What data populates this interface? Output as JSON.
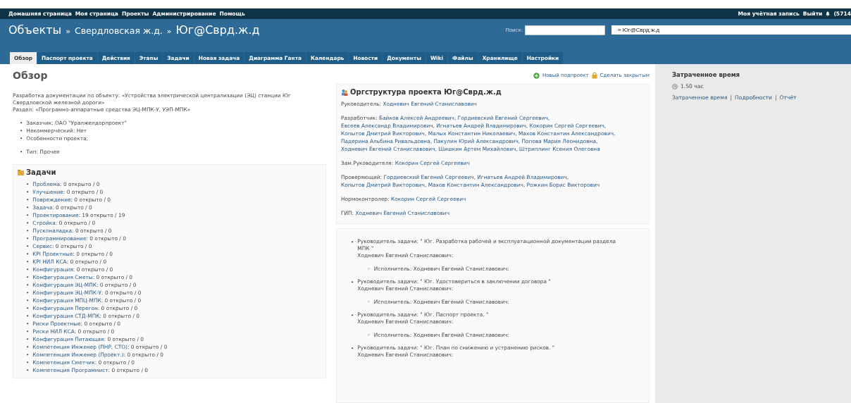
{
  "top_menu": [
    {
      "label": "Домашняя страница"
    },
    {
      "label": "Моя страница"
    },
    {
      "label": "Проекты"
    },
    {
      "label": "Администрирование"
    },
    {
      "label": "Помощь"
    }
  ],
  "account_menu": [
    {
      "label": "Моя учётная запись"
    },
    {
      "label": "Выйти"
    }
  ],
  "notifications": {
    "count": "(5714"
  },
  "breadcrumb": [
    {
      "text": "Объекты",
      "kind": "major"
    },
    {
      "text": "»",
      "kind": "separator"
    },
    {
      "text": "Свердловская ж.д.",
      "kind": "minor"
    },
    {
      "text": "»",
      "kind": "separator"
    },
    {
      "text": "Юг@Сврд.ж.д",
      "kind": "major"
    }
  ],
  "search": {
    "label": "Поиск:"
  },
  "project_select": {
    "value": "» Юг@Сврд.ж.д"
  },
  "tabs": [
    {
      "label": "Обзор",
      "selected": true
    },
    {
      "label": "Паспорт проекта",
      "selected": false
    },
    {
      "label": "Действия",
      "selected": false
    },
    {
      "label": "Этапы",
      "selected": false
    },
    {
      "label": "Задачи",
      "selected": false
    },
    {
      "label": "Новая задача",
      "selected": false
    },
    {
      "label": "Диаграмма Ганта",
      "selected": false
    },
    {
      "label": "Календарь",
      "selected": false
    },
    {
      "label": "Новости",
      "selected": false
    },
    {
      "label": "Документы",
      "selected": false
    },
    {
      "label": "Wiki",
      "selected": false
    },
    {
      "label": "Файлы",
      "selected": false
    },
    {
      "label": "Хранилище",
      "selected": false
    },
    {
      "label": "Настройки",
      "selected": false
    }
  ],
  "page_title": "Обзор",
  "actions": [
    {
      "label": "Новый подпроект",
      "kind": "add"
    },
    {
      "label": "Сделать закрытым",
      "kind": "lock"
    }
  ],
  "description": [
    "Разработка документации по объекту: «Устройства электрической централизации (ЭЦ) станции Юг Свердловской железной дороги»",
    "Раздел: «Програмно-аппаратные средства ЭЦ-МПК-У, УЭП-МПК»"
  ],
  "bullets": {
    "main": "•",
    "sub": "◦"
  },
  "custom_fields": [
    [
      "Заказчик: ОАО \"Уралжелдорпроект\"",
      "Некоммерческий: Нет",
      "Особенности проекта:"
    ],
    [
      "Тип: Прочее"
    ]
  ],
  "issues": {
    "title": "Задачи",
    "items": [
      {
        "tracker": "Проблема",
        "stats": ": 0 открыто / 0"
      },
      {
        "tracker": "Улучшение",
        "stats": ": 0 открыто / 0"
      },
      {
        "tracker": "Повреждение",
        "stats": ": 0 открыто / 0"
      },
      {
        "tracker": "Задача",
        "stats": ": 0 открыто / 0"
      },
      {
        "tracker": "Проектирование",
        "stats": ": 19 открыто / 19"
      },
      {
        "tracker": "Стройка",
        "stats": ": 0 открыто / 0"
      },
      {
        "tracker": "Пусконаладка",
        "stats": ": 0 открыто / 0"
      },
      {
        "tracker": "Программирование",
        "stats": ": 0 открыто / 0"
      },
      {
        "tracker": "Сервис",
        "stats": ": 0 открыто / 0"
      },
      {
        "tracker": "KPI Проектные",
        "stats": ": 0 открыто / 0"
      },
      {
        "tracker": "KPI НИЛ КСА",
        "stats": ": 0 открыто / 0"
      },
      {
        "tracker": "Конфигурация",
        "stats": ": 0 открыто / 0"
      },
      {
        "tracker": "Конфигурация Сметы",
        "stats": ": 0 открыто / 0"
      },
      {
        "tracker": "Конфигурация ЭЦ-МПК",
        "stats": ": 0 открыто / 0"
      },
      {
        "tracker": "Конфигурация ЭЦ-МПК-У",
        "stats": ": 0 открыто / 0"
      },
      {
        "tracker": "Конфигурация МПЦ-МПК",
        "stats": ": 0 открыто / 0"
      },
      {
        "tracker": "Конфигурация Перегон",
        "stats": ": 0 открыто / 0"
      },
      {
        "tracker": "Конфигурация СТД-МПК",
        "stats": ": 0 открыто / 0"
      },
      {
        "tracker": "Риски Проектные",
        "stats": ": 0 открыто / 0"
      },
      {
        "tracker": "Риски НИЛ КСА",
        "stats": ": 0 открыто / 0"
      },
      {
        "tracker": "Конфигурация Питающая",
        "stats": ": 0 открыто / 0"
      },
      {
        "tracker": "Компетенция Инженер (ПНР, СТО)",
        "stats": ": 0 открыто / 0"
      },
      {
        "tracker": "Компетенция Инженер (Проект.)",
        "stats": ": 0 открыто / 0"
      },
      {
        "tracker": "Компетенция Сметчик",
        "stats": ": 0 открыто / 0"
      },
      {
        "tracker": "Компетенция Программист",
        "stats": ": 0 открыто / 0"
      }
    ]
  },
  "org_structure": {
    "title": "Оргструктура проекта Юг@Сврд.ж.д",
    "roles": [
      {
        "role": "Руководитель:",
        "people": [
          "Ходневич Евгений Станиславович"
        ]
      },
      {
        "role": "Разработчик:",
        "people": [
          "Байков Алексей Андреевич,",
          "Гордиевский Евгений Сергеевич,",
          "Евсеев Александр Владимирович,",
          "Игнатьев Андрей Владимирович,",
          "Кокорин Сергей Сергеевич,",
          "Копытов Дмитрий Викторович,",
          "Малых Константин Николаевич,",
          "Махов Константин Александрович,",
          "Падерина Альбина Ривальдовна,",
          "Пакулин Юрий Александрович,",
          "Попова Мария Леонидовна,",
          "Ходневич Евгений Станиславович,",
          "Шишкин Артем Михайлович,",
          "Штриплинг Ксения Олеговна"
        ]
      },
      {
        "role": "Зам.Руководителя:",
        "people": [
          "Кокорин Сергей Сергеевич"
        ]
      },
      {
        "role": "Проверяющий:",
        "people": [
          "Гордиевский Евгений Сергеевич,",
          "Игнатьев Андрей Владимирович,",
          "Копытов Дмитрий Викторович,",
          "Махов Константин Александрович,",
          "Рожкин Борис Викторович"
        ]
      },
      {
        "role": "Нормоконтролер:",
        "people": [
          "Кокорин Сергей Сергеевич"
        ]
      },
      {
        "role": "ГИП:",
        "people": [
          "Ходневич Евгений Станиславович"
        ]
      }
    ]
  },
  "task_tree": [
    {
      "leader": "Руководитель задачи: \" Юг. Разработка рабочей и эксплуатационной документации раздела МПК \"",
      "person": "Ходневич  Евгений Станиславович:",
      "executors": [
        "Исполнитель:  Ходневич  Евгений Станиславович:"
      ]
    },
    {
      "leader": "Руководитель задачи: \" Юг. Удостовериться в заключении договора \"",
      "person": "Ходневич  Евгений Станиславович:",
      "executors": [
        "Исполнитель:  Ходневич  Евгений Станиславович:"
      ]
    },
    {
      "leader": "Руководитель задачи: \" Юг. Паспорт проекта. \"",
      "person": "Ходневич  Евгений Станиславович:",
      "executors": [
        "Исполнитель:  Ходневич  Евгений Станиславович:"
      ]
    },
    {
      "leader": "Руководитель задачи: \" Юг. План по снижению и устранению рисков. \"",
      "person": "Ходневич  Евгений Станиславович:"
    }
  ],
  "sidebar": {
    "title": "Затраченное время",
    "hours": "1.50 час",
    "links": [
      {
        "label": "Затраченное время",
        "kind": "link"
      },
      {
        "label": "|",
        "kind": "separator"
      },
      {
        "label": "Подробности",
        "kind": "link"
      },
      {
        "label": "|",
        "kind": "separator"
      },
      {
        "label": "Отчёт",
        "kind": "link"
      }
    ]
  }
}
